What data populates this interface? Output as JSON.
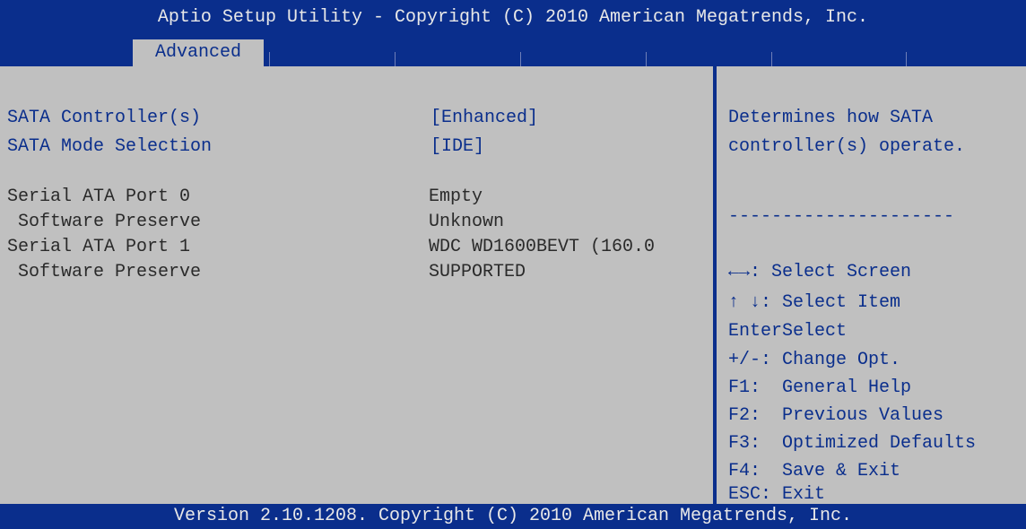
{
  "header": {
    "title": "Aptio Setup Utility - Copyright (C) 2010 American Megatrends, Inc.",
    "active_tab": "Advanced"
  },
  "settings": [
    {
      "label": "SATA Controller(s)",
      "value": "[Enhanced]"
    },
    {
      "label": "SATA Mode Selection",
      "value": "[IDE]"
    }
  ],
  "ports": [
    {
      "label": "Serial ATA Port 0",
      "value": "Empty"
    },
    {
      "label": " Software Preserve",
      "value": "Unknown"
    },
    {
      "label": "Serial ATA Port 1",
      "value": "WDC WD1600BEVT (160.0"
    },
    {
      "label": " Software Preserve",
      "value": "SUPPORTED"
    }
  ],
  "help_panel": {
    "description_line1": "Determines how SATA",
    "description_line2": "controller(s) operate.",
    "separator": "---------------------",
    "keys": [
      "←→: Select Screen",
      "↑ ↓: Select Item",
      "EnterSelect",
      "+/-: Change Opt.",
      "F1:  General Help",
      "F2:  Previous Values",
      "F3:  Optimized Defaults",
      "F4:  Save & Exit",
      "ESC: Exit"
    ]
  },
  "footer": {
    "text": "Version 2.10.1208. Copyright (C) 2010 American Megatrends, Inc."
  }
}
